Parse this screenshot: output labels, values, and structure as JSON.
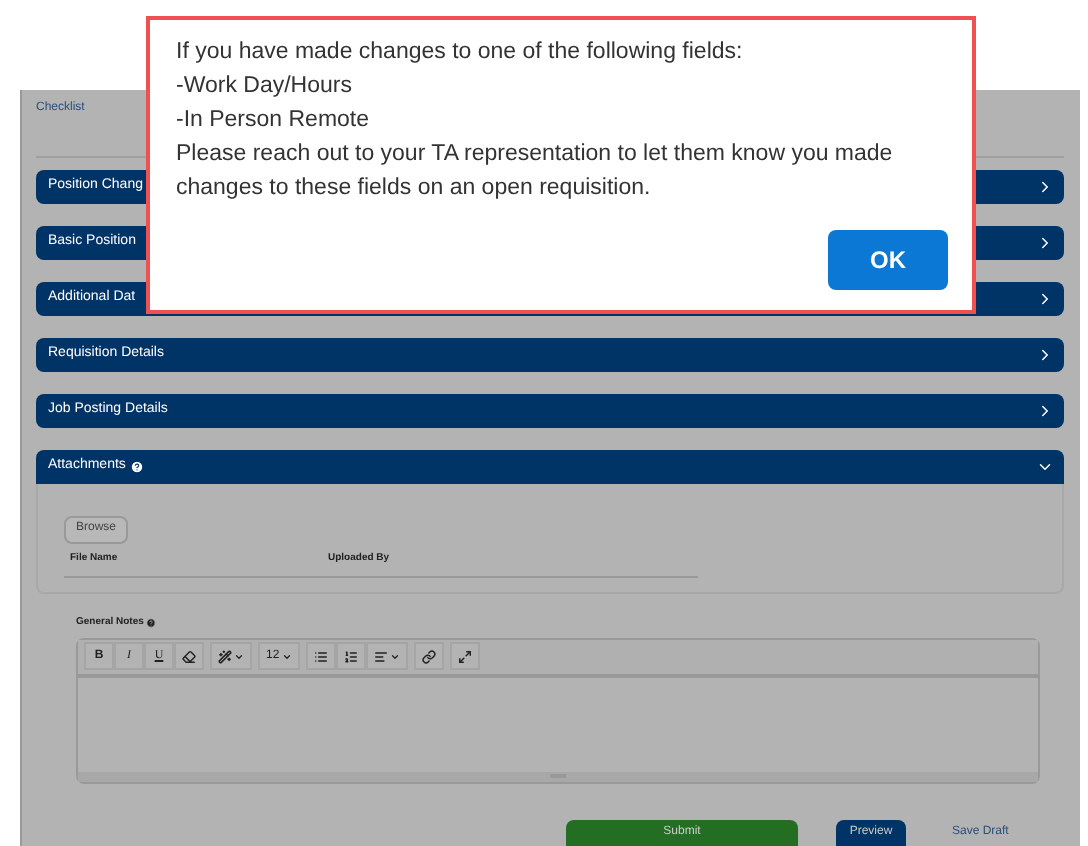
{
  "page": {
    "title": "Checklist"
  },
  "sections": [
    {
      "title": "Position Chang",
      "expanded": false,
      "help": false
    },
    {
      "title": "Basic Position",
      "expanded": false,
      "help": false
    },
    {
      "title": "Additional Dat",
      "expanded": false,
      "help": false
    },
    {
      "title": "Requisition Details",
      "expanded": false,
      "help": false
    },
    {
      "title": "Job Posting Details",
      "expanded": false,
      "help": false
    },
    {
      "title": "Attachments",
      "expanded": true,
      "help": true
    }
  ],
  "attachments": {
    "browse_button": "Browse",
    "columns": [
      "File Name",
      "Uploaded By"
    ]
  },
  "notes": {
    "label": "General Notes",
    "toolbar": [
      [
        {
          "kind": "text",
          "label": "B",
          "dropdown": false
        },
        {
          "kind": "text",
          "label": "I",
          "dropdown": false
        },
        {
          "kind": "text",
          "label": "U",
          "dropdown": false
        },
        {
          "kind": "icon",
          "dropdown": false
        }
      ],
      [
        {
          "kind": "icon",
          "dropdown": true
        }
      ],
      [
        {
          "kind": "text",
          "label": "12",
          "dropdown": true
        }
      ],
      [
        {
          "kind": "icon",
          "dropdown": false
        },
        {
          "kind": "icon",
          "dropdown": false
        },
        {
          "kind": "icon",
          "dropdown": true
        }
      ],
      [
        {
          "kind": "icon",
          "dropdown": false
        }
      ],
      [
        {
          "kind": "icon",
          "dropdown": false
        }
      ]
    ]
  },
  "actions": {
    "submit": "Submit",
    "preview": "Preview",
    "save_draft": "Save Draft"
  },
  "dialog": {
    "lines": [
      "If you have made changes to one of the following fields:",
      "-Work Day/Hours",
      "-In Person Remote",
      "Please reach out to your TA representation to let them know you made changes to these fields on an open requisition."
    ],
    "ok_button": "OK"
  }
}
